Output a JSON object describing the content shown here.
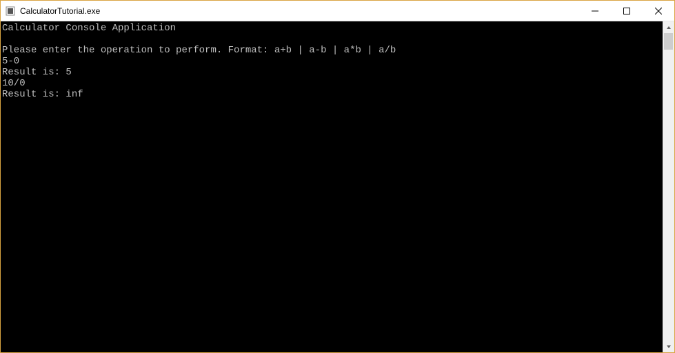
{
  "window": {
    "title": "CalculatorTutorial.exe"
  },
  "console": {
    "lines": [
      "Calculator Console Application",
      "",
      "Please enter the operation to perform. Format: a+b | a-b | a*b | a/b",
      "5-0",
      "Result is: 5",
      "10/0",
      "Result is: inf"
    ]
  }
}
